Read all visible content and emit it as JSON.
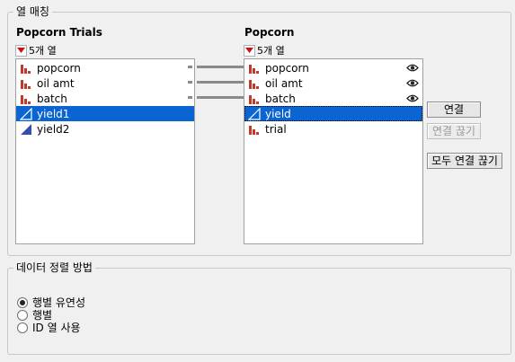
{
  "match_group": {
    "title": "열 매칭",
    "left": {
      "title": "Popcorn Trials",
      "count_label": "5개 열",
      "items": [
        {
          "label": "popcorn",
          "icon": "bar-chart-icon"
        },
        {
          "label": "oil amt",
          "icon": "bar-chart-icon"
        },
        {
          "label": "batch",
          "icon": "bar-chart-icon"
        },
        {
          "label": "yield1",
          "icon": "continuous-triangle-icon"
        },
        {
          "label": "yield2",
          "icon": "continuous-triangle-icon"
        }
      ]
    },
    "right": {
      "title": "Popcorn",
      "count_label": "5개 열",
      "items": [
        {
          "label": "popcorn",
          "icon": "bar-chart-icon"
        },
        {
          "label": "oil amt",
          "icon": "bar-chart-icon"
        },
        {
          "label": "batch",
          "icon": "bar-chart-icon"
        },
        {
          "label": "yield",
          "icon": "continuous-triangle-icon"
        },
        {
          "label": "trial",
          "icon": "bar-chart-icon"
        }
      ]
    },
    "buttons": {
      "link": "연결",
      "unlink": "연결 끊기",
      "unlink_all": "모두 연결 끊기"
    }
  },
  "sort_group": {
    "title": "데이터 정렬 방법",
    "options": [
      "행별 유연성",
      "행별",
      "ID 열 사용"
    ],
    "selected": "행별 유연성"
  },
  "colors": {
    "selection": "#0a64d2",
    "nominal_icon": "#c0392b",
    "continuous_icon": "#3050b0"
  }
}
